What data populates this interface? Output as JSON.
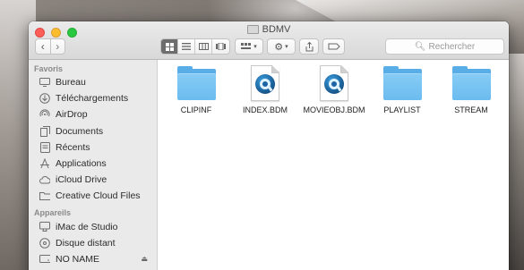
{
  "window": {
    "title": "BDMV"
  },
  "toolbar": {
    "search_placeholder": "Rechercher"
  },
  "sidebar": {
    "favorites_header": "Favoris",
    "favorites": [
      {
        "label": "Bureau",
        "icon": "desktop-icon"
      },
      {
        "label": "Téléchargements",
        "icon": "downloads-icon"
      },
      {
        "label": "AirDrop",
        "icon": "airdrop-icon"
      },
      {
        "label": "Documents",
        "icon": "documents-icon"
      },
      {
        "label": "Récents",
        "icon": "recents-icon"
      },
      {
        "label": "Applications",
        "icon": "applications-icon"
      },
      {
        "label": "iCloud Drive",
        "icon": "cloud-icon"
      },
      {
        "label": "Creative Cloud Files",
        "icon": "folder-icon"
      }
    ],
    "devices_header": "Appareils",
    "devices": [
      {
        "label": "iMac de Studio",
        "icon": "imac-icon"
      },
      {
        "label": "Disque distant",
        "icon": "disc-icon"
      },
      {
        "label": "NO NAME",
        "icon": "drive-icon"
      }
    ]
  },
  "files": [
    {
      "name": "CLIPINF",
      "kind": "folder"
    },
    {
      "name": "INDEX.BDM",
      "kind": "quicktime-document"
    },
    {
      "name": "MOVIEOBJ.BDM",
      "kind": "quicktime-document"
    },
    {
      "name": "PLAYLIST",
      "kind": "folder"
    },
    {
      "name": "STREAM",
      "kind": "folder"
    }
  ]
}
